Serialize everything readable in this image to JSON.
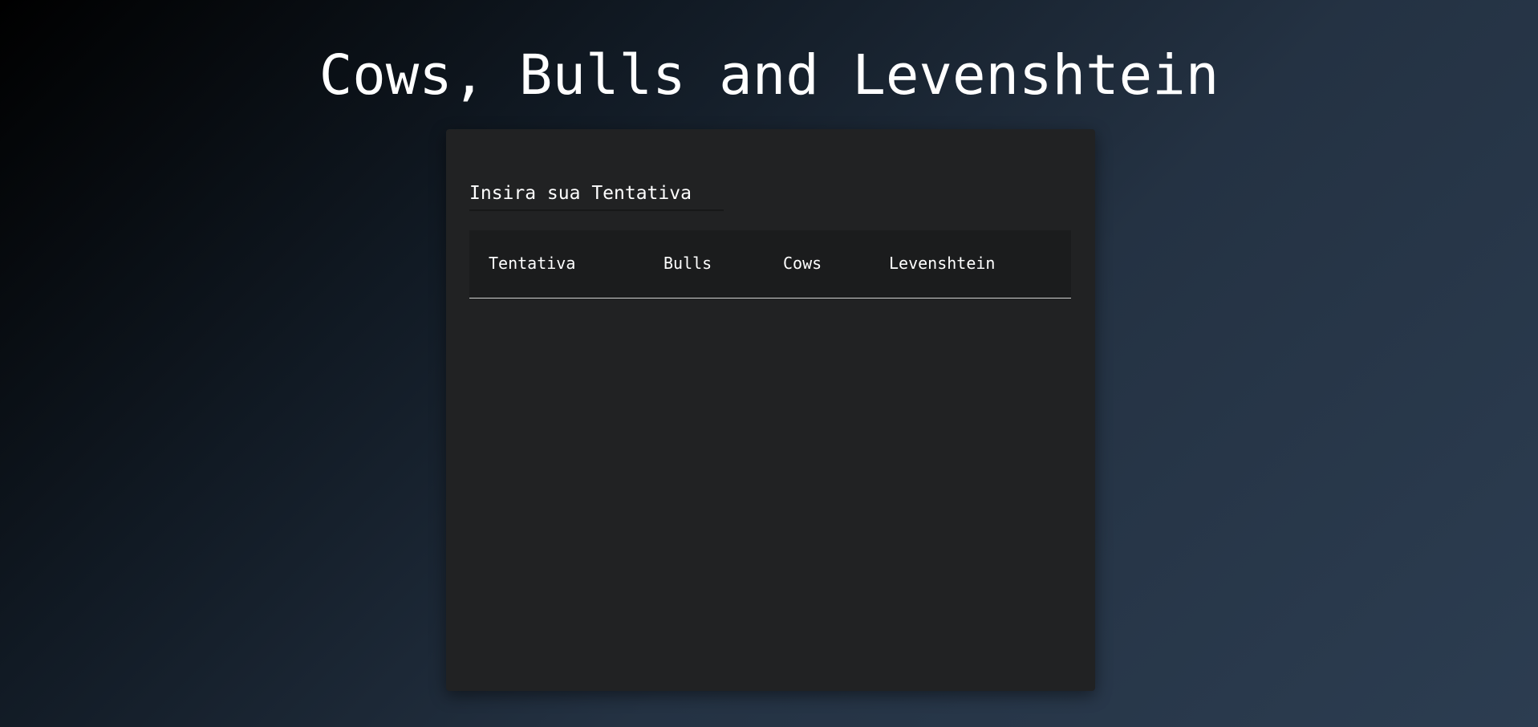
{
  "title": "Cows, Bulls and Levenshtein",
  "guess_input": {
    "placeholder": "Insira sua Tentativa",
    "value": ""
  },
  "table": {
    "columns": [
      "Tentativa",
      "Bulls",
      "Cows",
      "Levenshtein"
    ],
    "rows": []
  }
}
